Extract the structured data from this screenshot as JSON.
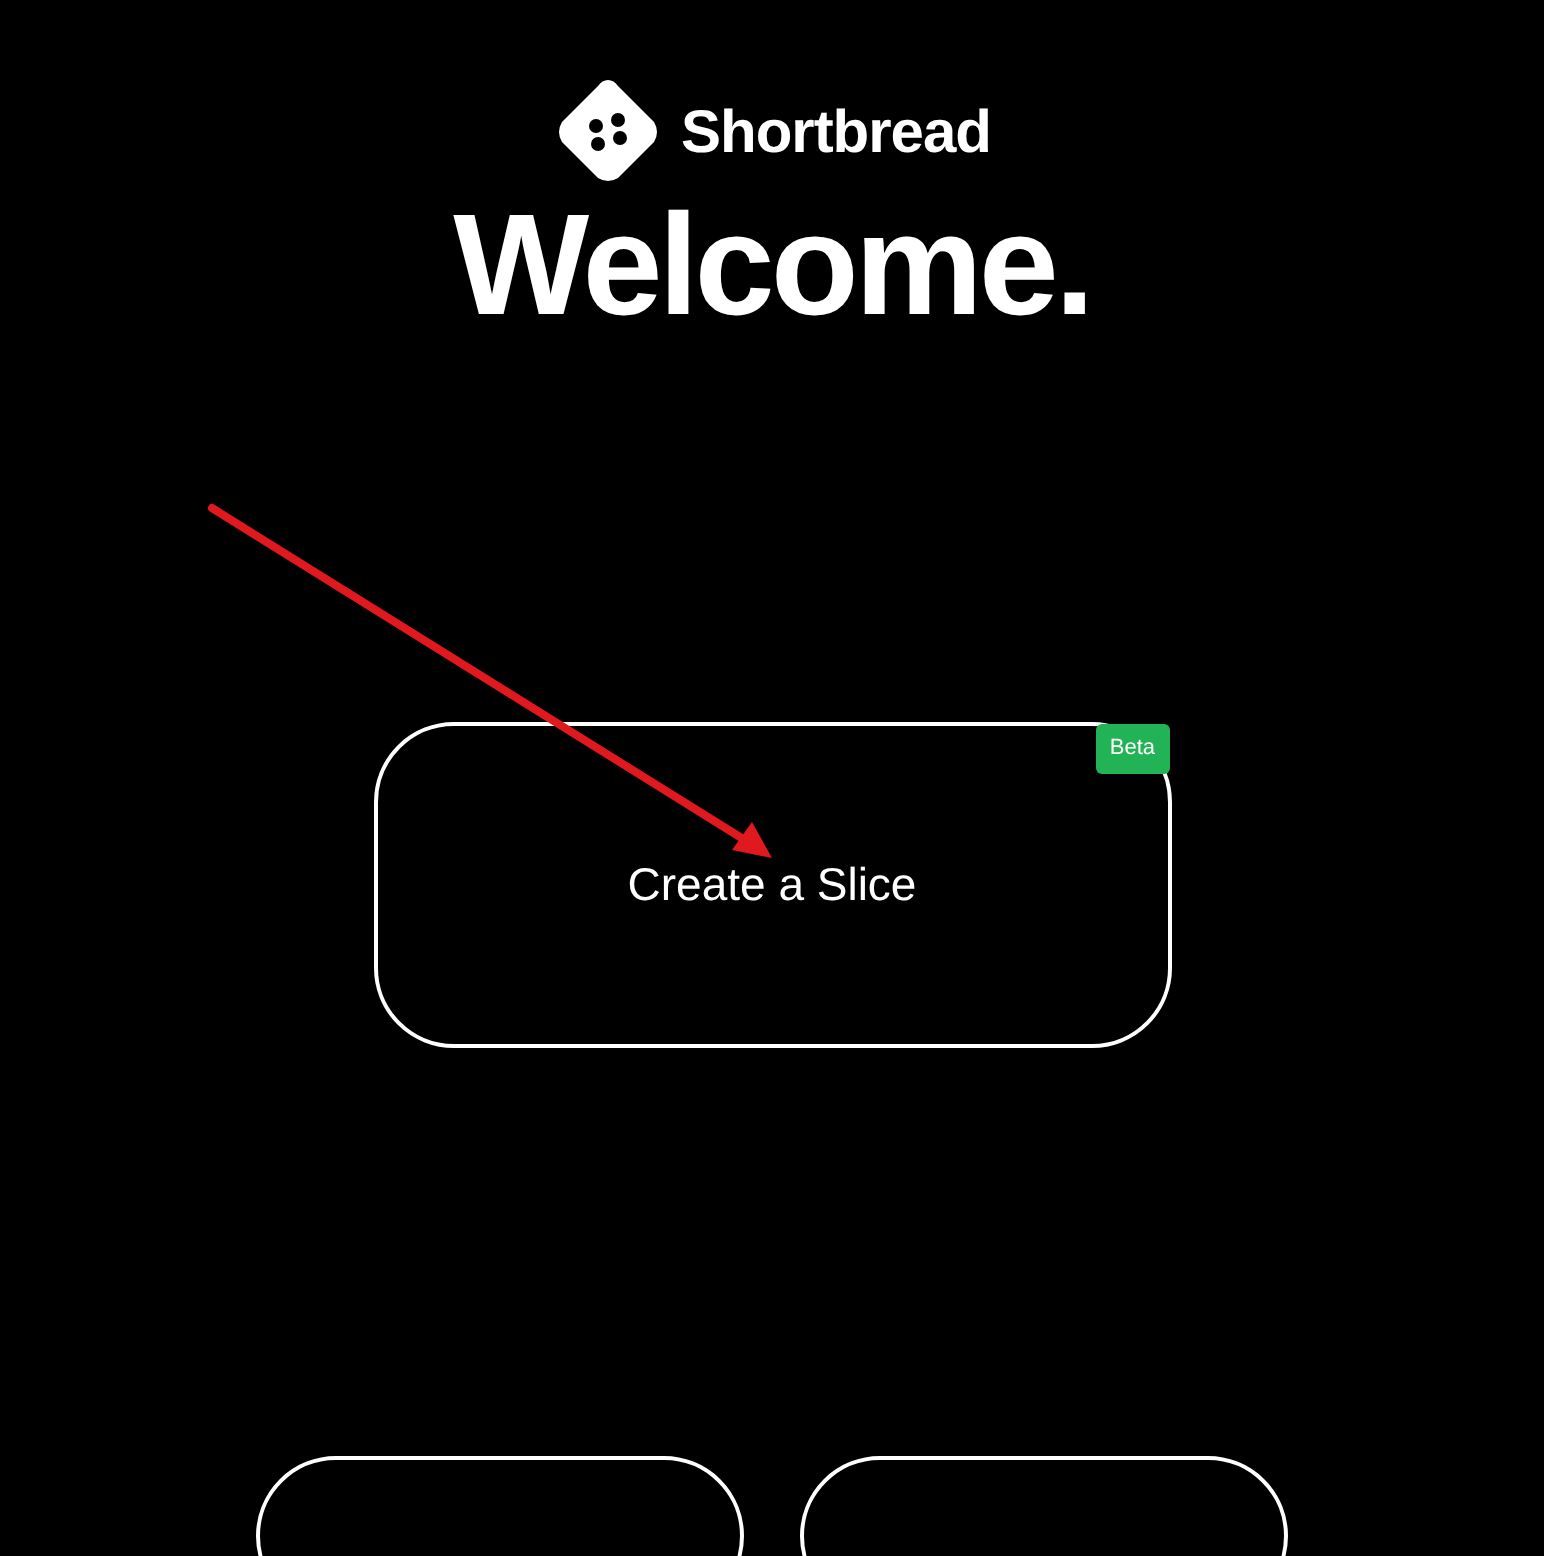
{
  "brand": {
    "name": "Shortbread"
  },
  "heading": "Welcome.",
  "main_card": {
    "label": "Create a Slice",
    "badge": "Beta"
  },
  "annotation": {
    "kind": "arrow",
    "color": "#e0191f"
  },
  "more_cards": [
    {
      "kind": "card"
    },
    {
      "kind": "card"
    }
  ]
}
